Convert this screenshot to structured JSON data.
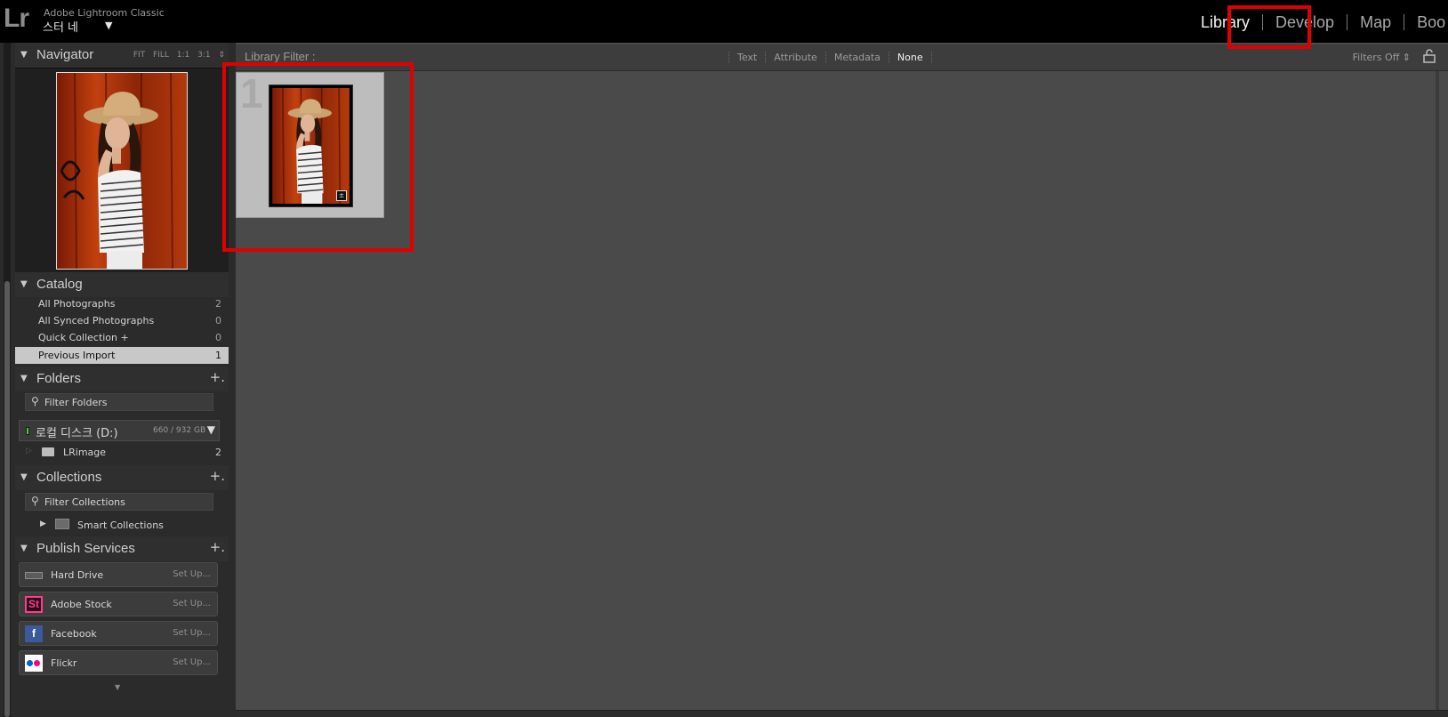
{
  "app": {
    "logo": "Lr",
    "name": "Adobe Lightroom Classic",
    "identity": "스터 네",
    "identity_arrow": "▼"
  },
  "modules": {
    "library": "Library",
    "develop": "Develop",
    "map": "Map",
    "book": "Boo"
  },
  "navigator": {
    "title": "Navigator",
    "options": "FIT FILL 1:1 3:1 ⇕"
  },
  "catalog": {
    "title": "Catalog",
    "items": [
      {
        "label": "All Photographs",
        "count": "2"
      },
      {
        "label": "All Synced Photographs",
        "count": "0"
      },
      {
        "label": "Quick Collection  +",
        "count": "0"
      },
      {
        "label": "Previous Import",
        "count": "1",
        "selected": true
      }
    ]
  },
  "folders": {
    "title": "Folders",
    "add": "+.",
    "filter_placeholder": "Filter Folders",
    "volume": {
      "name": "로컬 디스크 (D:)",
      "size": "660 / 932 GB",
      "arrow": "▼"
    },
    "items": [
      {
        "label": "LRimage",
        "count": "2"
      }
    ]
  },
  "collections": {
    "title": "Collections",
    "add": "+.",
    "filter_placeholder": "Filter Collections",
    "items": [
      {
        "label": "Smart Collections"
      }
    ]
  },
  "publish": {
    "title": "Publish Services",
    "add": "+.",
    "items": [
      {
        "label": "Hard Drive",
        "action": "Set Up...",
        "icon": "hard-drive-icon"
      },
      {
        "label": "Adobe Stock",
        "action": "Set Up...",
        "icon": "adobe-stock-icon",
        "icon_text": "St"
      },
      {
        "label": "Facebook",
        "action": "Set Up...",
        "icon": "facebook-icon",
        "icon_text": "f"
      },
      {
        "label": "Flickr",
        "action": "Set Up...",
        "icon": "flickr-icon"
      }
    ]
  },
  "filter_bar": {
    "label": "Library Filter :",
    "options": [
      "Text",
      "Attribute",
      "Metadata",
      "None"
    ],
    "active": "None",
    "filters_off": "Filters Off ⇕"
  },
  "grid": {
    "cells": [
      {
        "index": "1"
      }
    ]
  },
  "colors": {
    "highlight": "#e00000",
    "panel": "#2b2b2b",
    "grid_bg": "#4a4a4a",
    "cell_bg": "#bdbdbd"
  }
}
